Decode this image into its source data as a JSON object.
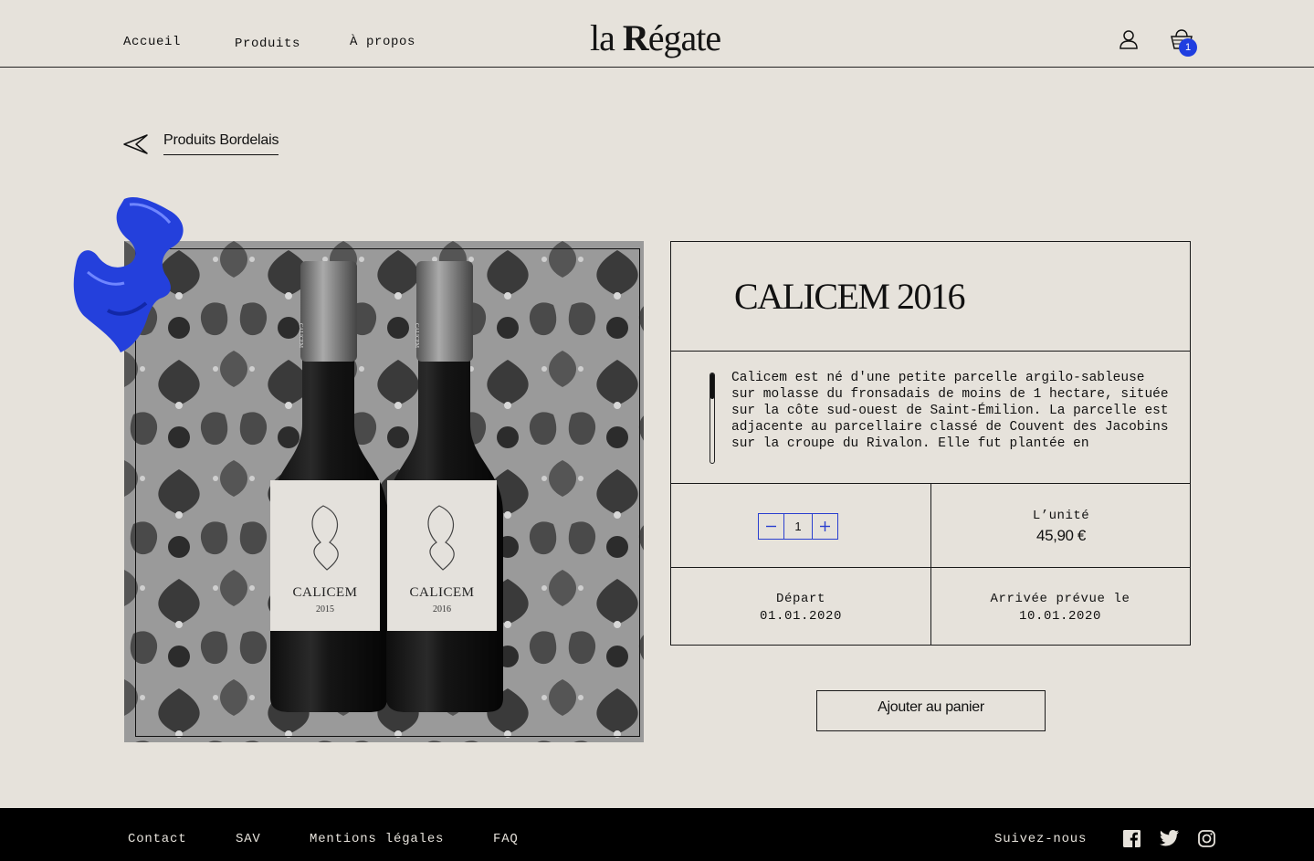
{
  "header": {
    "nav": [
      "Accueil",
      "Produits",
      "À propos"
    ],
    "logo": {
      "pre": "la ",
      "r": "R",
      "post": "égate"
    },
    "cart_count": "1"
  },
  "breadcrumb": {
    "label": "Produits Bordelais"
  },
  "product": {
    "title": "CALICEM 2016",
    "description": "Calicem est né d'une petite parcelle argilo-sableuse sur molasse du fronsadais de moins de 1 hectare, située sur la côte sud-ouest de Saint-Émilion. La parcelle est adjacente au parcellaire classé de Couvent des Jacobins sur la croupe du Rivalon. Elle fut plantée en",
    "quantity": "1",
    "unit_label": "L’unité",
    "unit_price": "45,90 €",
    "departure_label": "Départ",
    "departure_date": "01.01.2020",
    "arrival_label": "Arrivée prévue le",
    "arrival_date": "10.01.2020",
    "add_to_cart": "Ajouter au panier",
    "bottles": [
      {
        "name": "CALICEM",
        "year": "2015",
        "cap": "CALICEM"
      },
      {
        "name": "CALICEM",
        "year": "2016",
        "cap": "CALICEM"
      }
    ]
  },
  "footer": {
    "links": [
      "Contact",
      "SAV",
      "Mentions légales",
      "FAQ"
    ],
    "follow": "Suivez-nous"
  },
  "colors": {
    "background": "#e6e2db",
    "accent": "#1f3ee0",
    "footer": "#000000"
  }
}
